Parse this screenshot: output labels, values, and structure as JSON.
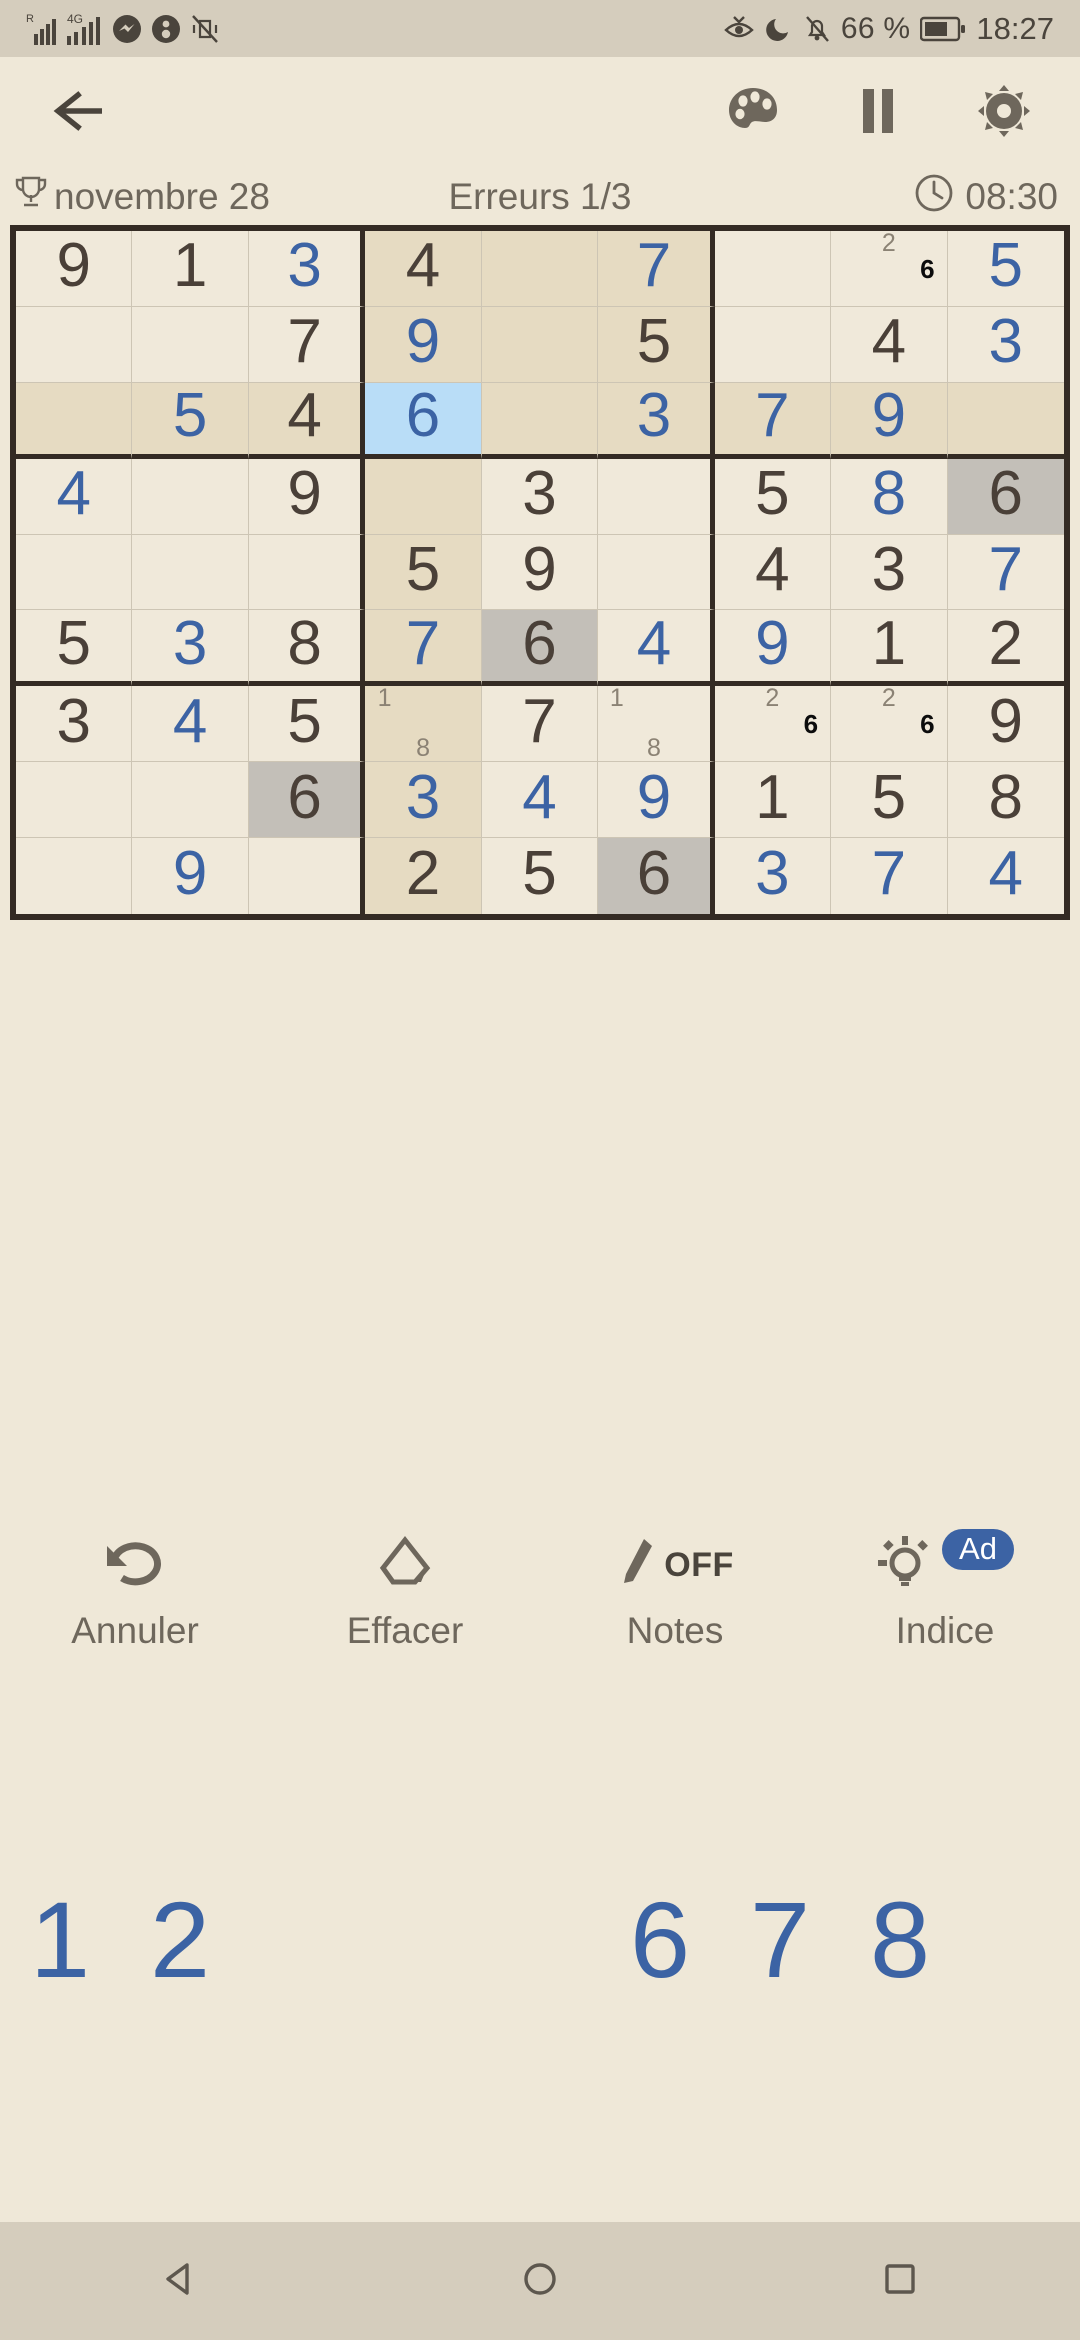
{
  "status_bar": {
    "roaming_label": "R",
    "network_label": "4G",
    "battery_percent": "66 %",
    "clock": "18:27",
    "icons": [
      "signal-icon",
      "signal-4g-icon",
      "messenger-icon",
      "app-icon",
      "vibrate-off-icon",
      "eye-comfort-icon",
      "do-not-disturb-icon",
      "notifications-muted-icon",
      "battery-icon"
    ]
  },
  "app_bar": {
    "back": "back-arrow-icon",
    "theme": "palette-icon",
    "pause": "pause-icon",
    "settings": "gear-icon"
  },
  "info": {
    "trophy_icon": "trophy-icon",
    "date": "novembre 28",
    "errors": "Erreurs 1/3",
    "clock_icon": "clock-icon",
    "timer": "08:30"
  },
  "colors": {
    "background": "#efe8d8",
    "cell_bg": "#f0e9da",
    "cell_highlight": "#e6dbc2",
    "cell_selected": "#b9ddf7",
    "cell_conflict": "#c3bfb8",
    "given_text": "#4a4038",
    "user_text": "#3c63a4",
    "grid_line": "#342b24",
    "accent": "#3c63a4"
  },
  "board": {
    "selected": {
      "row": 3,
      "col": 4
    },
    "cells": [
      [
        {
          "v": "9",
          "t": "given"
        },
        {
          "v": "1",
          "t": "given"
        },
        {
          "v": "3",
          "t": "user"
        },
        {
          "v": "4",
          "t": "given",
          "bg": "hl"
        },
        {
          "v": "",
          "t": "empty",
          "bg": "hl"
        },
        {
          "v": "7",
          "t": "user",
          "bg": "hl"
        },
        {
          "v": "",
          "t": "empty"
        },
        {
          "v": "",
          "t": "empty",
          "notes": {
            "2": "n",
            "6": "b"
          }
        },
        {
          "v": "5",
          "t": "user"
        }
      ],
      [
        {
          "v": "",
          "t": "empty"
        },
        {
          "v": "",
          "t": "empty"
        },
        {
          "v": "7",
          "t": "given"
        },
        {
          "v": "9",
          "t": "user",
          "bg": "hl"
        },
        {
          "v": "",
          "t": "empty",
          "bg": "hl"
        },
        {
          "v": "5",
          "t": "given",
          "bg": "hl"
        },
        {
          "v": "",
          "t": "empty"
        },
        {
          "v": "4",
          "t": "given"
        },
        {
          "v": "3",
          "t": "user"
        }
      ],
      [
        {
          "v": "",
          "t": "empty",
          "bg": "hl"
        },
        {
          "v": "5",
          "t": "user",
          "bg": "hl"
        },
        {
          "v": "4",
          "t": "given",
          "bg": "hl"
        },
        {
          "v": "6",
          "t": "user",
          "bg": "sel"
        },
        {
          "v": "",
          "t": "empty",
          "bg": "hl"
        },
        {
          "v": "3",
          "t": "user",
          "bg": "hl"
        },
        {
          "v": "7",
          "t": "user",
          "bg": "hl"
        },
        {
          "v": "9",
          "t": "user",
          "bg": "hl"
        },
        {
          "v": "",
          "t": "empty",
          "bg": "hl"
        }
      ],
      [
        {
          "v": "4",
          "t": "user"
        },
        {
          "v": "",
          "t": "empty"
        },
        {
          "v": "9",
          "t": "given"
        },
        {
          "v": "",
          "t": "empty",
          "bg": "hl"
        },
        {
          "v": "3",
          "t": "given"
        },
        {
          "v": "",
          "t": "empty"
        },
        {
          "v": "5",
          "t": "given"
        },
        {
          "v": "8",
          "t": "user"
        },
        {
          "v": "6",
          "t": "given",
          "bg": "conf"
        }
      ],
      [
        {
          "v": "",
          "t": "empty"
        },
        {
          "v": "",
          "t": "empty"
        },
        {
          "v": "",
          "t": "empty"
        },
        {
          "v": "5",
          "t": "given",
          "bg": "hl"
        },
        {
          "v": "9",
          "t": "given"
        },
        {
          "v": "",
          "t": "empty"
        },
        {
          "v": "4",
          "t": "given"
        },
        {
          "v": "3",
          "t": "given"
        },
        {
          "v": "7",
          "t": "user"
        }
      ],
      [
        {
          "v": "5",
          "t": "given"
        },
        {
          "v": "3",
          "t": "user"
        },
        {
          "v": "8",
          "t": "given"
        },
        {
          "v": "7",
          "t": "user",
          "bg": "hl"
        },
        {
          "v": "6",
          "t": "given",
          "bg": "conf"
        },
        {
          "v": "4",
          "t": "user"
        },
        {
          "v": "9",
          "t": "user"
        },
        {
          "v": "1",
          "t": "given"
        },
        {
          "v": "2",
          "t": "given"
        }
      ],
      [
        {
          "v": "3",
          "t": "given"
        },
        {
          "v": "4",
          "t": "user"
        },
        {
          "v": "5",
          "t": "given"
        },
        {
          "v": "",
          "t": "empty",
          "bg": "hl",
          "notes": {
            "1": "n",
            "8": "n"
          }
        },
        {
          "v": "7",
          "t": "given"
        },
        {
          "v": "",
          "t": "empty",
          "notes": {
            "1": "n",
            "8": "n"
          }
        },
        {
          "v": "",
          "t": "empty",
          "notes": {
            "2": "n",
            "6": "b"
          }
        },
        {
          "v": "",
          "t": "empty",
          "notes": {
            "2": "n",
            "6": "b"
          }
        },
        {
          "v": "9",
          "t": "given"
        }
      ],
      [
        {
          "v": "",
          "t": "empty"
        },
        {
          "v": "",
          "t": "empty"
        },
        {
          "v": "6",
          "t": "given",
          "bg": "conf"
        },
        {
          "v": "3",
          "t": "user",
          "bg": "hl"
        },
        {
          "v": "4",
          "t": "user"
        },
        {
          "v": "9",
          "t": "user"
        },
        {
          "v": "1",
          "t": "given"
        },
        {
          "v": "5",
          "t": "given"
        },
        {
          "v": "8",
          "t": "given"
        }
      ],
      [
        {
          "v": "",
          "t": "empty"
        },
        {
          "v": "9",
          "t": "user"
        },
        {
          "v": "",
          "t": "empty"
        },
        {
          "v": "2",
          "t": "given",
          "bg": "hl"
        },
        {
          "v": "5",
          "t": "given"
        },
        {
          "v": "6",
          "t": "given",
          "bg": "conf"
        },
        {
          "v": "3",
          "t": "user"
        },
        {
          "v": "7",
          "t": "user"
        },
        {
          "v": "4",
          "t": "user"
        }
      ]
    ]
  },
  "tools": [
    {
      "icon": "undo-icon",
      "label": "Annuler"
    },
    {
      "icon": "eraser-icon",
      "label": "Effacer"
    },
    {
      "icon": "pencil-icon",
      "label": "Notes",
      "state": "OFF"
    },
    {
      "icon": "lightbulb-icon",
      "label": "Indice",
      "badge": "Ad"
    }
  ],
  "numpad": [
    {
      "n": "1",
      "visible": true
    },
    {
      "n": "2",
      "visible": true
    },
    {
      "n": "3",
      "visible": false
    },
    {
      "n": "4",
      "visible": false
    },
    {
      "n": "5",
      "visible": false
    },
    {
      "n": "6",
      "visible": true
    },
    {
      "n": "7",
      "visible": true
    },
    {
      "n": "8",
      "visible": true
    },
    {
      "n": "9",
      "visible": false
    }
  ],
  "nav_bar": {
    "back": "nav-back-triangle-icon",
    "home": "nav-home-circle-icon",
    "recents": "nav-recents-square-icon"
  }
}
